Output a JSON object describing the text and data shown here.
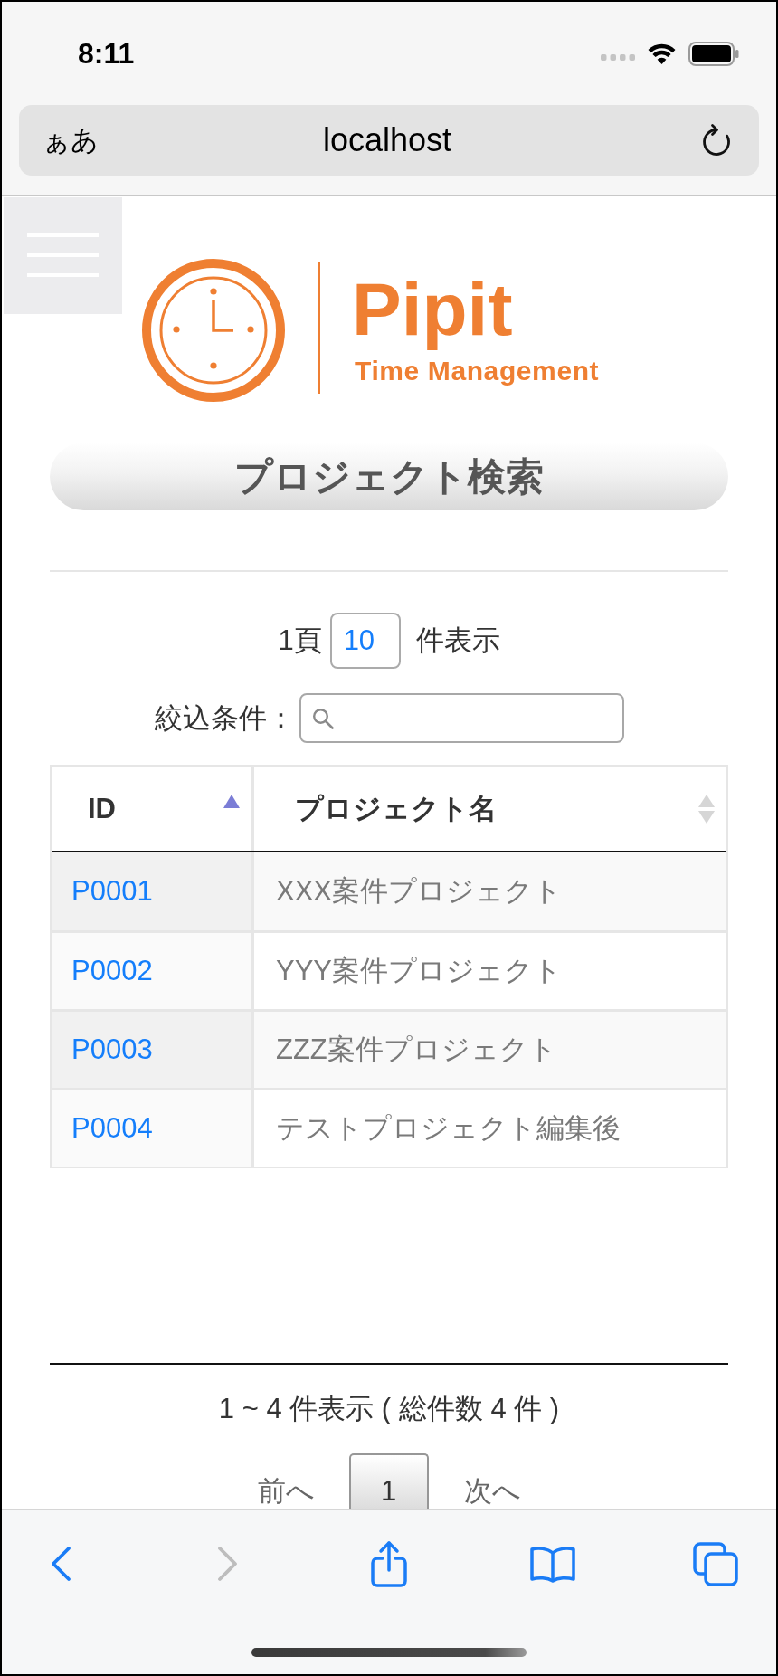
{
  "status_bar": {
    "time": "8:11"
  },
  "address_bar": {
    "text_size_button": "ぁあ",
    "url": "localhost"
  },
  "logo": {
    "name": "Pipit",
    "tagline": "Time Management"
  },
  "page_title": "プロジェクト検索",
  "length_menu": {
    "prefix": "1頁",
    "value": "10",
    "suffix": "件表示"
  },
  "filter": {
    "label": "絞込条件："
  },
  "table": {
    "columns": [
      {
        "label": "ID",
        "sorted": true
      },
      {
        "label": "プロジェクト名",
        "sorted": false
      }
    ],
    "rows": [
      {
        "id": "P0001",
        "name": "XXX案件プロジェクト"
      },
      {
        "id": "P0002",
        "name": "YYY案件プロジェクト"
      },
      {
        "id": "P0003",
        "name": "ZZZ案件プロジェクト"
      },
      {
        "id": "P0004",
        "name": "テストプロジェクト編集後"
      }
    ]
  },
  "info": "1 ~ 4 件表示 ( 総件数 4 件 )",
  "pagination": {
    "previous": {
      "label": "前へ",
      "disabled": true
    },
    "pages": [
      {
        "label": "1",
        "selected": true
      }
    ],
    "next": {
      "label": "次へ",
      "disabled": true
    }
  },
  "toolbar": {
    "items": [
      {
        "kind": "back",
        "disabled": false
      },
      {
        "kind": "forward",
        "disabled": true
      },
      {
        "kind": "share",
        "disabled": false
      },
      {
        "kind": "bookmarks",
        "disabled": false
      },
      {
        "kind": "tabs",
        "disabled": false
      }
    ]
  }
}
